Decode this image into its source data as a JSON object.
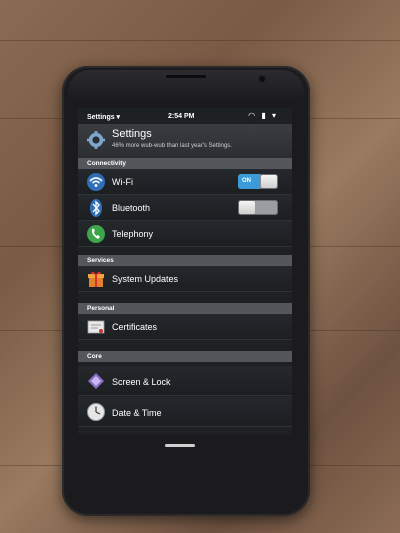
{
  "statusbar": {
    "app": "Settings ▾",
    "time": "2:54 PM",
    "icons": "◠ ▮ ▾"
  },
  "header": {
    "title": "Settings",
    "subtitle": "46% more wub-wub than last year's Settings.",
    "icon": "gear-icon"
  },
  "sections": {
    "connectivity": "Connectivity",
    "services": "Services",
    "personal": "Personal",
    "core": "Core"
  },
  "items": {
    "wifi": {
      "label": "Wi-Fi",
      "icon": "wifi-icon",
      "toggle_text": "ON",
      "toggle_on": true
    },
    "bluetooth": {
      "label": "Bluetooth",
      "icon": "bluetooth-icon",
      "toggle_on": false
    },
    "telephony": {
      "label": "Telephony",
      "icon": "phone-icon"
    },
    "system_updates": {
      "label": "System Updates",
      "icon": "gift-box-icon"
    },
    "certificates": {
      "label": "Certificates",
      "icon": "certificate-icon"
    },
    "screen_lock": {
      "label": "Screen & Lock",
      "icon": "lock-icon"
    },
    "date_time": {
      "label": "Date & Time",
      "icon": "clock-icon"
    }
  },
  "colors": {
    "accent": "#3b9bd8",
    "section_bg": "#53575c",
    "screen_bg": "#1e2124"
  }
}
